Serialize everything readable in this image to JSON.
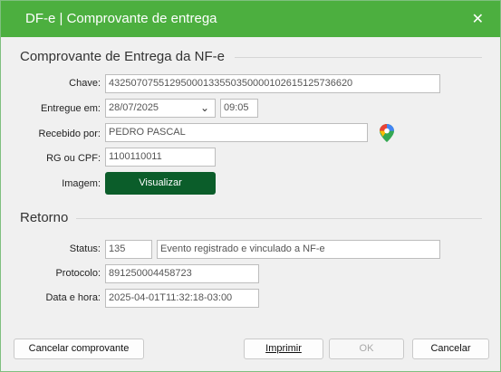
{
  "window": {
    "title": "DF-e | Comprovante de entrega",
    "close_glyph": "✕"
  },
  "section_entrega": {
    "title": "Comprovante de Entrega da NF-e",
    "chave": {
      "label": "Chave:",
      "value": "43250707551295000133550350000102615125736620"
    },
    "entregue_em": {
      "label": "Entregue em:",
      "date": "28/07/2025",
      "time": "09:05"
    },
    "recebido_por": {
      "label": "Recebido por:",
      "value": "PEDRO PASCAL",
      "map_icon": "map-pin-icon"
    },
    "rg_cpf": {
      "label": "RG ou CPF:",
      "value": "1100110011"
    },
    "imagem": {
      "label": "Imagem:",
      "button": "Visualizar"
    }
  },
  "section_retorno": {
    "title": "Retorno",
    "status": {
      "label": "Status:",
      "code": "135",
      "description": "Evento registrado e vinculado a NF-e"
    },
    "protocolo": {
      "label": "Protocolo:",
      "value": "891250004458723"
    },
    "data_hora": {
      "label": "Data e hora:",
      "value": "2025-04-01T11:32:18-03:00"
    }
  },
  "footer": {
    "cancel_receipt": "Cancelar comprovante",
    "print": "Imprimir",
    "ok": "OK",
    "cancel": "Cancelar"
  },
  "colors": {
    "titlebar": "#4caf3f",
    "primary_button": "#0b5d2a"
  }
}
